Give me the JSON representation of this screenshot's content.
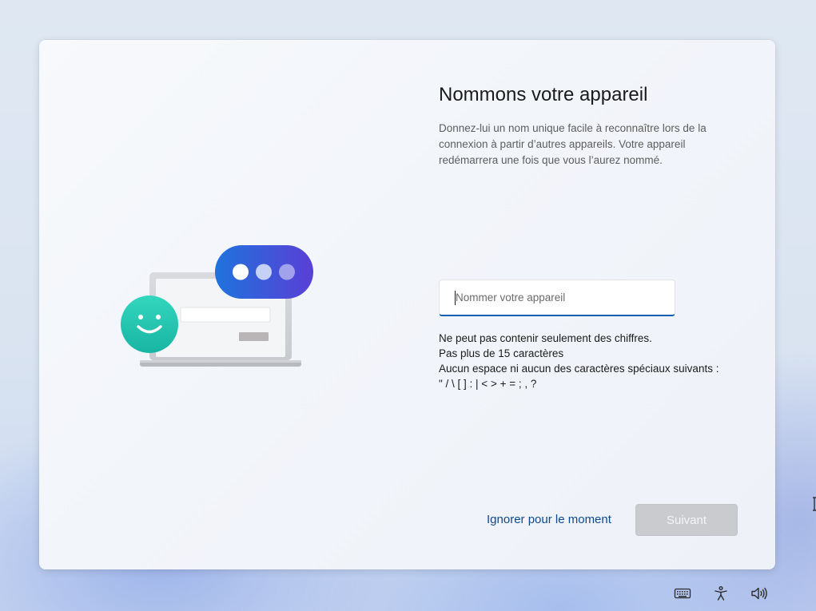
{
  "screen": {
    "title": "Nommons votre appareil",
    "description": "Donnez-lui un nom unique facile à reconnaître lors de la connexion à partir d’autres appareils. Votre appareil redémarrera une fois que vous l’aurez nommé.",
    "device_name_input": {
      "value": "",
      "placeholder": "Nommer votre appareil"
    },
    "rules": [
      "Ne peut pas contenir seulement des chiffres.",
      "Pas plus de 15 caractères",
      "Aucun espace ni aucun des caractères spéciaux suivants :",
      "\" / \\ [ ] : | < > + = ; , ?"
    ],
    "skip_label": "Ignorer pour le moment",
    "next_label": "Suivant"
  },
  "taskbar": {
    "icons": [
      "keyboard-icon",
      "accessibility-icon",
      "volume-icon"
    ]
  },
  "colors": {
    "accent": "#0f5eb0",
    "link": "#0b4a8f",
    "button_disabled": "#c9cbcf",
    "bubble_start": "#1f73dd",
    "bubble_end": "#5a3fd6",
    "smiley": "#22c5ae"
  }
}
